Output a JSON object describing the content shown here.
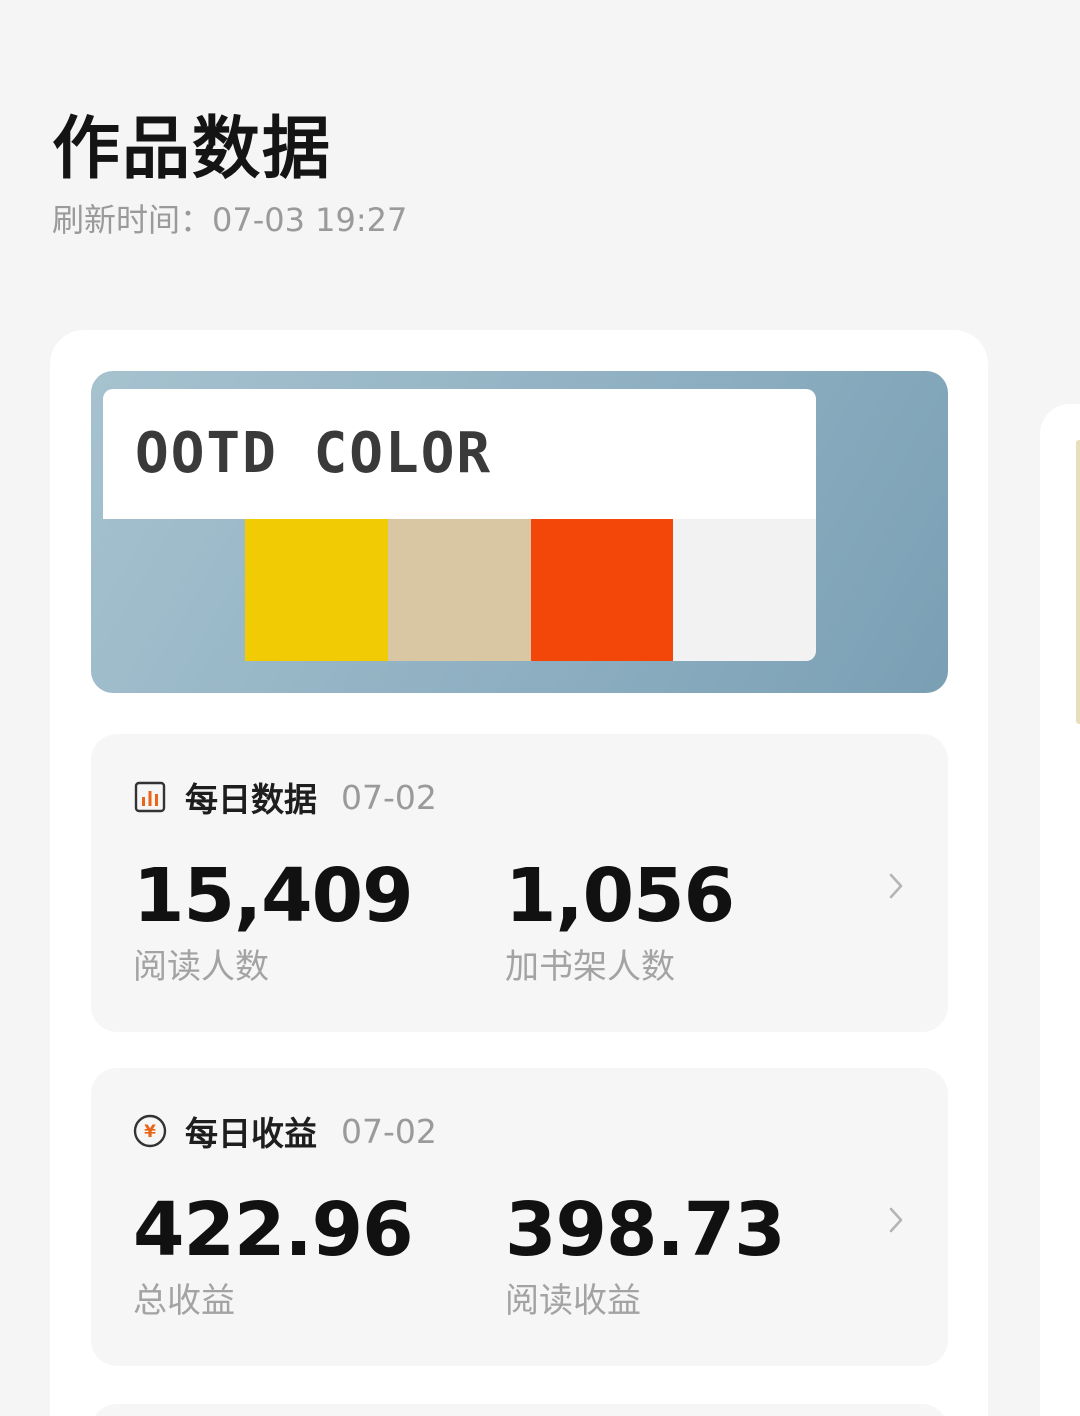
{
  "header": {
    "title": "作品数据",
    "refresh_label": "刷新时间：",
    "refresh_time": "07-03 19:27"
  },
  "cover": {
    "text": "OOTD COLOR",
    "swatches": [
      "#f1cc04",
      "#d9c6a2",
      "#f24708",
      "#f2f2f2"
    ]
  },
  "daily_data": {
    "icon": "bar-chart-icon",
    "title": "每日数据",
    "date": "07-02",
    "metrics": [
      {
        "value": "15,409",
        "label": "阅读人数"
      },
      {
        "value": "1,056",
        "label": "加书架人数"
      }
    ]
  },
  "daily_income": {
    "icon": "yuan-coin-icon",
    "title": "每日收益",
    "date": "07-02",
    "metrics": [
      {
        "value": "422.96",
        "label": "总收益"
      },
      {
        "value": "398.73",
        "label": "阅读收益"
      }
    ]
  },
  "colors": {
    "background": "#f5f5f5",
    "card": "#ffffff",
    "panel": "#f6f6f6",
    "coin_accent": "#e8661a"
  }
}
